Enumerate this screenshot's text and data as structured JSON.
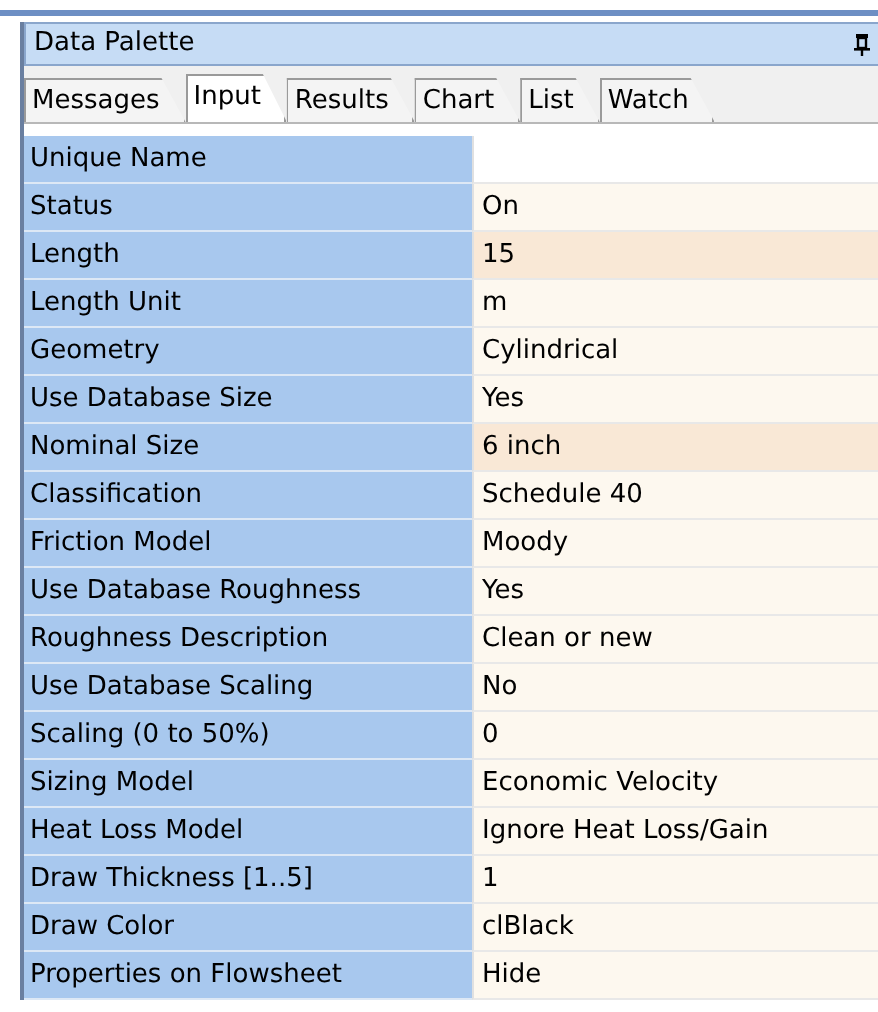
{
  "window": {
    "title": "Data Palette"
  },
  "tabs": [
    {
      "label": "Messages",
      "selected": false
    },
    {
      "label": "Input",
      "selected": true
    },
    {
      "label": "Results",
      "selected": false
    },
    {
      "label": "Chart",
      "selected": false
    },
    {
      "label": "List",
      "selected": false
    },
    {
      "label": "Watch",
      "selected": false
    }
  ],
  "properties": [
    {
      "name": "Unique Name",
      "highlighted": false
    },
    {
      "name": "Status",
      "value": "On",
      "highlighted": false
    },
    {
      "name": "Length",
      "value": "15",
      "highlighted": true
    },
    {
      "name": "Length Unit",
      "value": "m",
      "highlighted": false
    },
    {
      "name": "Geometry",
      "value": "Cylindrical",
      "highlighted": false
    },
    {
      "name": "Use Database Size",
      "value": "Yes",
      "highlighted": false
    },
    {
      "name": "Nominal Size",
      "value": "6 inch",
      "highlighted": true
    },
    {
      "name": "Classification",
      "value": "Schedule 40",
      "highlighted": false
    },
    {
      "name": "Friction Model",
      "value": "Moody",
      "highlighted": false
    },
    {
      "name": "Use Database Roughness",
      "value": "Yes",
      "highlighted": false
    },
    {
      "name": "Roughness Description",
      "value": "Clean or new",
      "highlighted": false
    },
    {
      "name": "Use Database Scaling",
      "value": "No",
      "highlighted": false
    },
    {
      "name": "Scaling (0 to 50%)",
      "value": "0",
      "highlighted": false
    },
    {
      "name": "Sizing Model",
      "value": "Economic Velocity",
      "highlighted": false
    },
    {
      "name": "Heat Loss Model",
      "value": "Ignore Heat Loss/Gain",
      "highlighted": false
    },
    {
      "name": "Draw Thickness [1..5]",
      "value": "1",
      "highlighted": false
    },
    {
      "name": "Draw Color",
      "value": "clBlack",
      "highlighted": false
    },
    {
      "name": "Properties on Flowsheet",
      "value": "Hide",
      "highlighted": false
    }
  ]
}
